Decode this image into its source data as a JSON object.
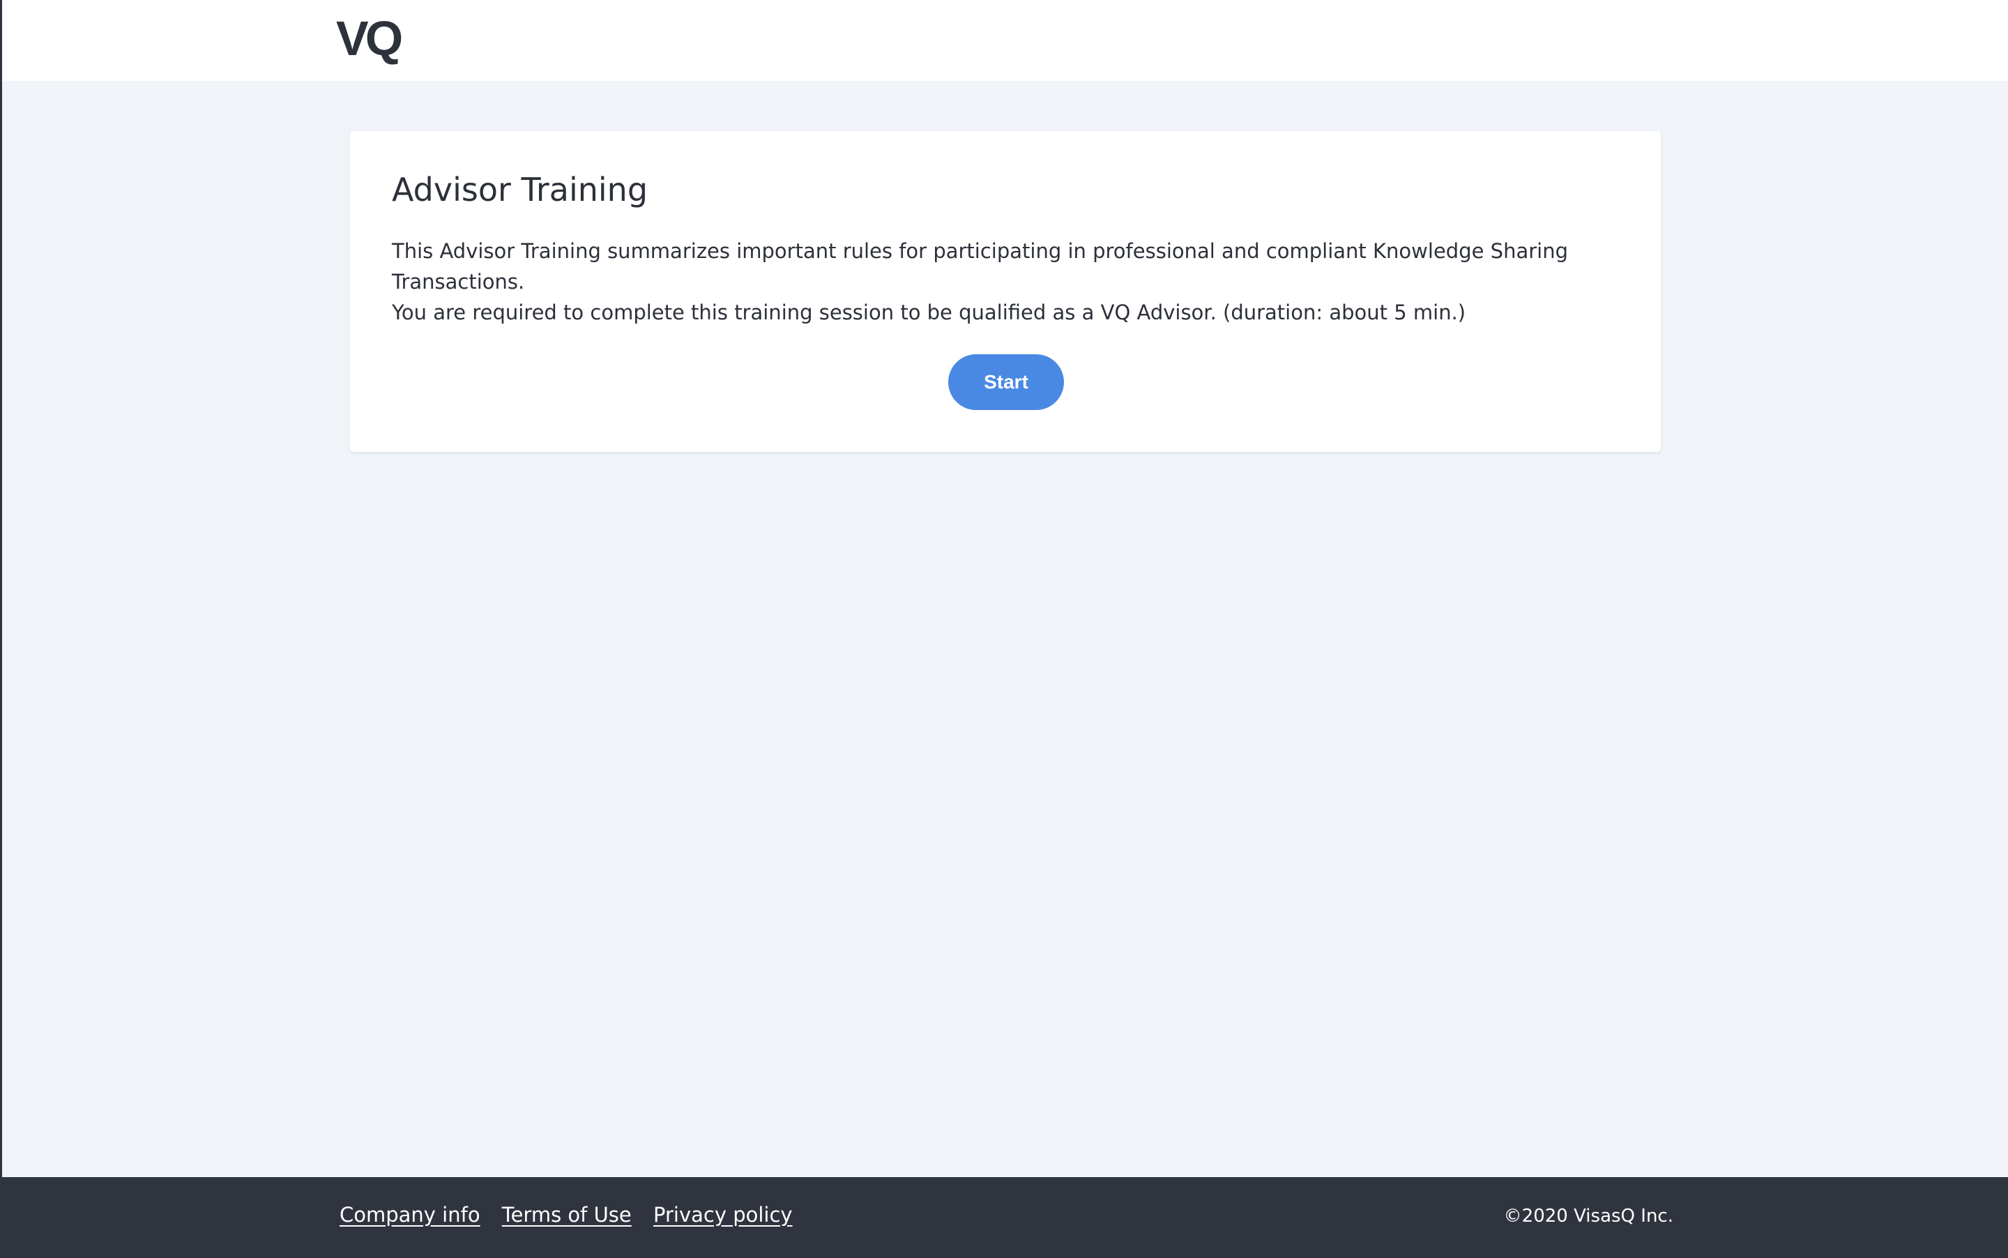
{
  "header": {
    "logo_text": "VQ"
  },
  "card": {
    "title": "Advisor Training",
    "description_line_1": "This Advisor Training summarizes important rules for participating in professional and compliant Knowledge Sharing Transactions.",
    "description_line_2": "You are required to complete this training session to be qualified as a VQ Advisor. (duration: about 5 min.)",
    "start_label": "Start"
  },
  "footer": {
    "links": [
      {
        "label": "Company info"
      },
      {
        "label": "Terms of Use"
      },
      {
        "label": "Privacy policy"
      }
    ],
    "copyright": "©2020 VisasQ Inc."
  },
  "colors": {
    "page_background": "#f0f4f8",
    "header_background": "#ffffff",
    "card_background": "#ffffff",
    "accent_button": "#4a89e3",
    "footer_background": "#30343e",
    "text_primary": "#2c3039"
  }
}
